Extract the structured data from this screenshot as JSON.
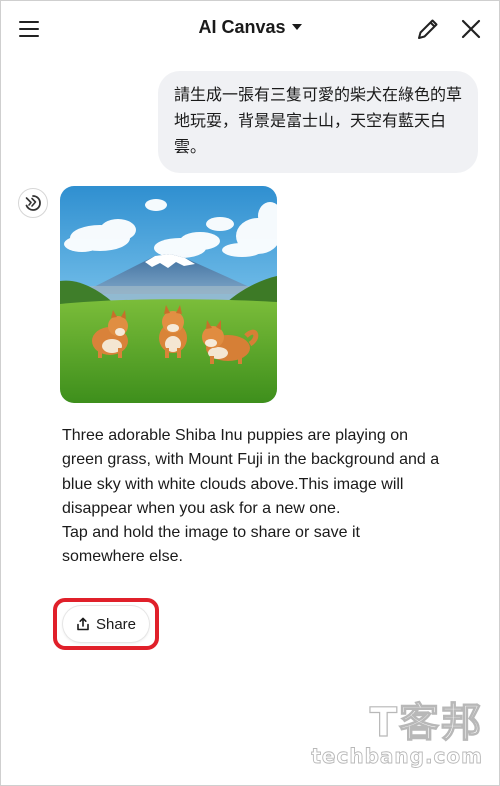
{
  "header": {
    "title": "AI Canvas",
    "menu_icon": "hamburger-menu-icon",
    "edit_icon": "pencil-edit-icon",
    "close_icon": "close-icon"
  },
  "user_message": {
    "text": "請生成一張有三隻可愛的柴犬在綠色的草地玩耍，背景是富士山，天空有藍天白雲。"
  },
  "response": {
    "avatar_icon": "ai-assistant-logo-icon",
    "image_icon": "generated-image",
    "paragraph_1": "Three adorable Shiba Inu puppies are playing on green grass, with Mount Fuji in the background and a blue sky with white clouds above.This image will disappear when you ask for a new one.",
    "paragraph_2": "Tap and hold the image to share or save it somewhere else.",
    "share_label": "Share",
    "share_icon": "share-upload-icon"
  },
  "watermark": {
    "main": "T客邦",
    "sub": "techbang.com"
  },
  "colors": {
    "highlight_border": "#e0202a",
    "bubble_bg": "#f0f1f4",
    "text": "#1a1a1a"
  }
}
